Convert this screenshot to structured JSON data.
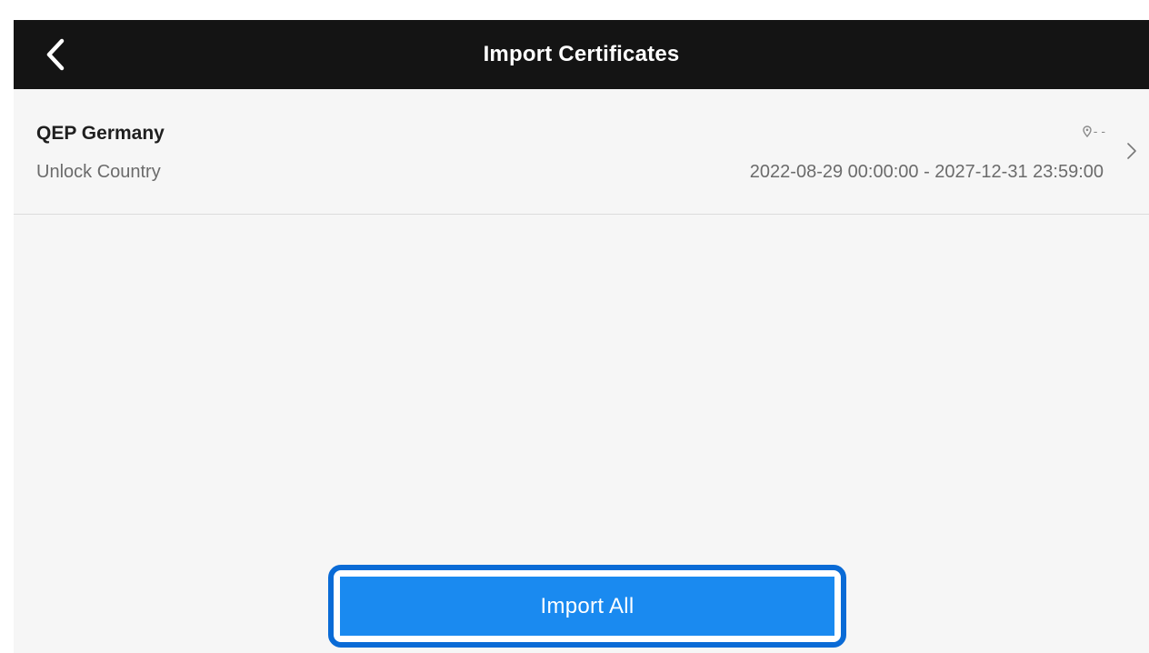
{
  "header": {
    "title": "Import Certificates",
    "back_icon": "chevron-left-icon"
  },
  "certificates": [
    {
      "name": "QEP Germany",
      "type": "Unlock Country",
      "location": "- -",
      "location_icon": "location-pin-icon",
      "validity": "2022-08-29 00:00:00 - 2027-12-31 23:59:00",
      "chevron_icon": "chevron-right-icon"
    }
  ],
  "actions": {
    "import_all_label": "Import All"
  },
  "colors": {
    "header_bg": "#141414",
    "screen_bg": "#f6f6f6",
    "primary_button": "#1a8af0",
    "highlight_border": "#0a6bd6"
  }
}
